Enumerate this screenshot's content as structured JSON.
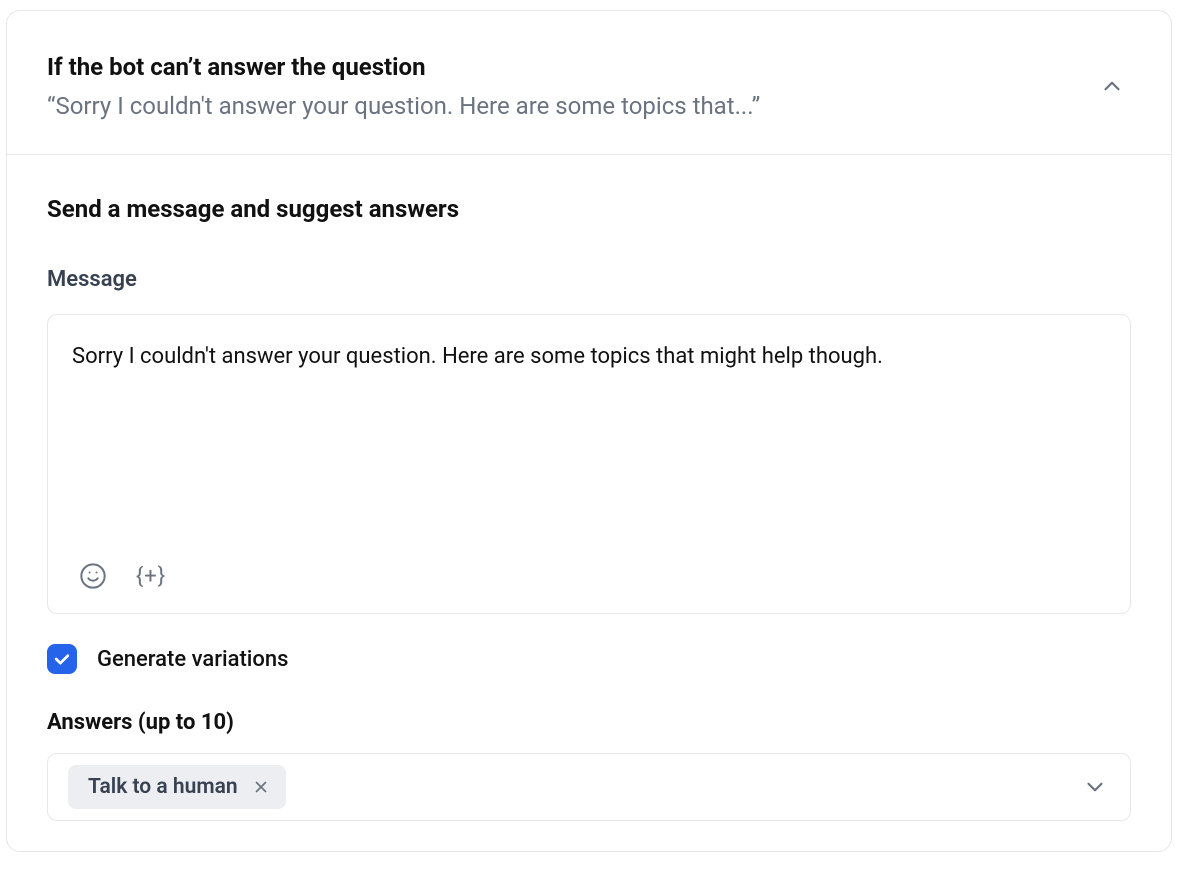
{
  "header": {
    "title": "If the bot can’t answer the question",
    "subtitle": "“Sorry I couldn't answer your question. Here are some topics that...”"
  },
  "section": {
    "title": "Send a message and suggest answers",
    "messageLabel": "Message",
    "messageValue": "Sorry I couldn't answer your question. Here are some topics that might help though.",
    "variableButtonText": "{+}",
    "generateVariations": {
      "checked": true,
      "label": "Generate variations"
    },
    "answersLabel": "Answers (up to 10)",
    "answers": [
      {
        "label": "Talk to a human"
      }
    ]
  }
}
